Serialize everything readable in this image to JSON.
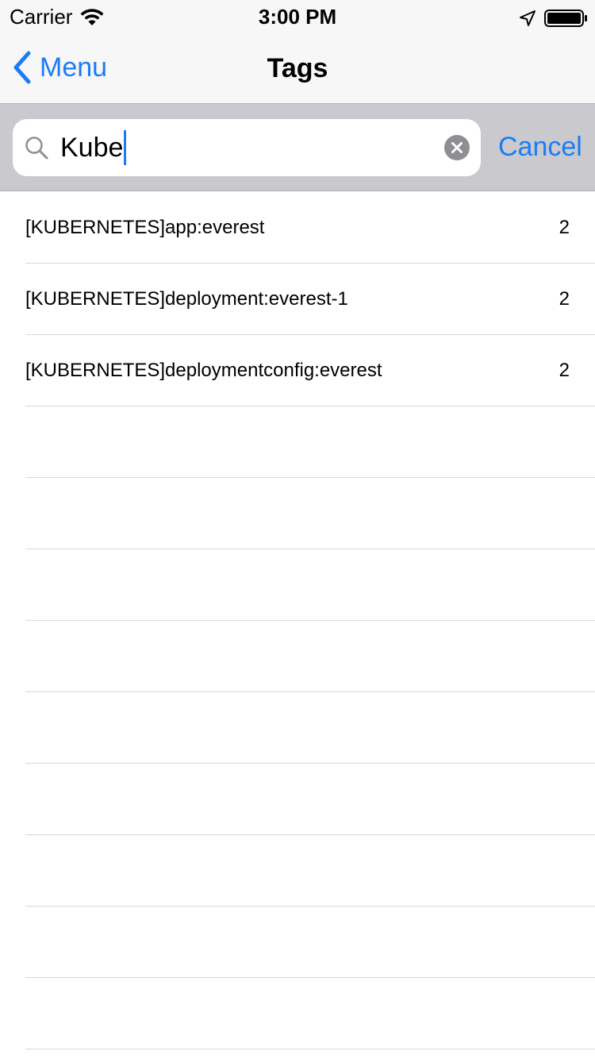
{
  "status_bar": {
    "carrier": "Carrier",
    "time": "3:00 PM"
  },
  "nav": {
    "back_label": "Menu",
    "title": "Tags"
  },
  "search": {
    "query": "Kube",
    "cancel_label": "Cancel"
  },
  "tags": [
    {
      "label": "[KUBERNETES]app:everest",
      "count": "2"
    },
    {
      "label": "[KUBERNETES]deployment:everest-1",
      "count": "2"
    },
    {
      "label": "[KUBERNETES]deploymentconfig:everest",
      "count": "2"
    }
  ],
  "colors": {
    "accent": "#1b7cf6",
    "search_background": "#c9c9ce",
    "bar_background": "#f7f7f7"
  }
}
